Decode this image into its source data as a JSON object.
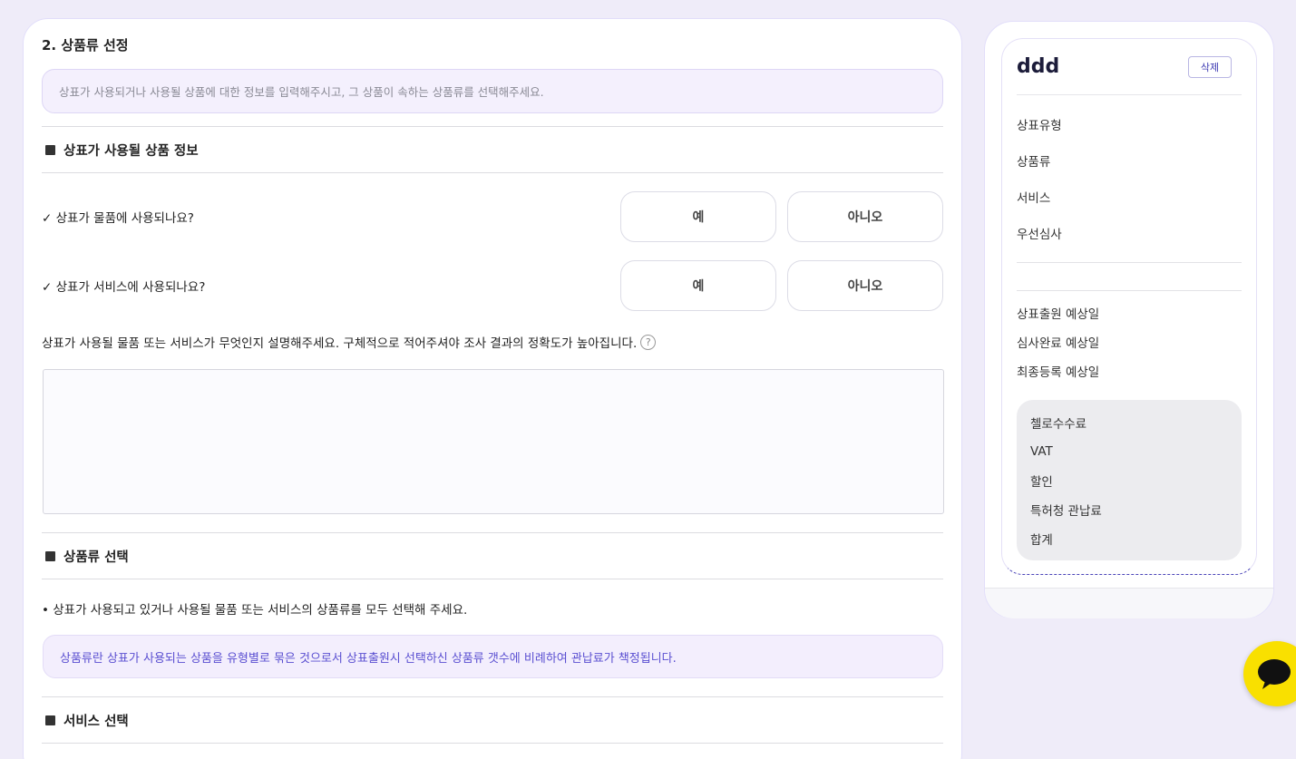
{
  "main": {
    "section_title": "2. 상품류 선정",
    "intro_info": "상표가 사용되거나 사용될 상품에 대한 정보를 입력해주시고, 그 상품이 속하는 상품류를 선택해주세요.",
    "product_info_header": "상표가 사용될 상품 정보",
    "q_goods": "✓ 상표가 물품에 사용되나요?",
    "q_service": "✓ 상표가 서비스에 사용되나요?",
    "yes_label": "예",
    "no_label": "아니오",
    "describe_label": "상표가 사용될 물품 또는 서비스가 무엇인지 설명해주세요. 구체적으로 적어주셔야 조사 결과의 정확도가 높아집니다.",
    "help_symbol": "?",
    "class_select_header": "상품류 선택",
    "class_select_bullet": "• 상표가 사용되고 있거나 사용될 물품 또는 서비스의 상품류를 모두 선택해 주세요.",
    "class_info": "상품류란 상표가 사용되는 상품을 유형별로 묶은 것으로서 상표출원시 선택하신 상품류 갯수에 비례하여 관납료가 책정됩니다.",
    "service_select_header": "서비스 선택"
  },
  "sidebar": {
    "name": "ddd",
    "delete_label": "삭제",
    "items": [
      "상표유형",
      "상품류",
      "서비스",
      "우선심사"
    ],
    "dates": [
      "상표출원 예상일",
      "심사완료 예상일",
      "최종등록 예상일"
    ],
    "fees": [
      "첼로수수료",
      "VAT",
      "할인",
      "특허청 관납료",
      "합계"
    ]
  },
  "colors": {
    "accent": "#5a4fd1",
    "chat_yellow": "#f9e000"
  }
}
